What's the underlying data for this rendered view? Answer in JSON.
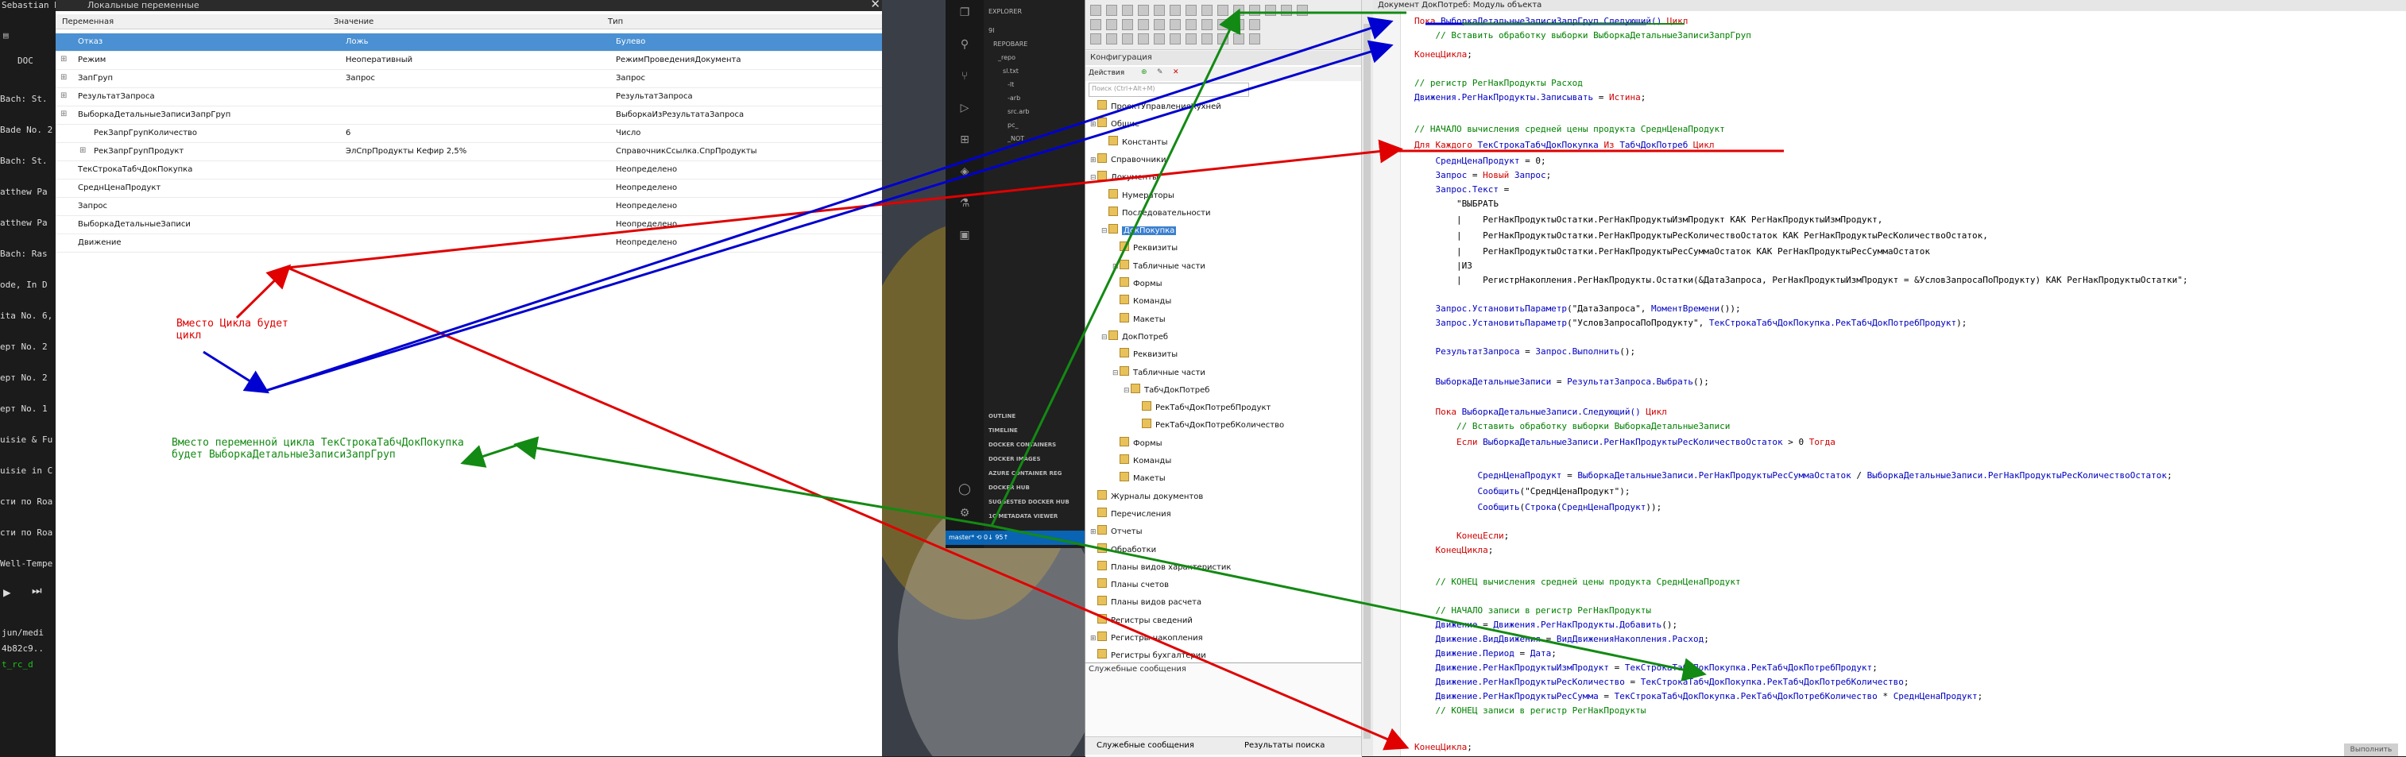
{
  "left_strip": {
    "user": "Sebastian B",
    "tab": "DOC",
    "tracks": [
      "Bach: St.",
      "Bade No. 2",
      "Bach: St.",
      "atthew Pa",
      "atthew Pa",
      "Bach: Ras",
      "ode, In D",
      "ita No. 6,",
      "ерт No. 2",
      "ерт No. 2",
      "ерт No. 1",
      "uisie & Fu",
      "uisie in C",
      "сти по Roa",
      "сти по Roa",
      "Well-Tempe"
    ],
    "path_lines": [
      "jun/medi",
      "4b82c9..",
      "t_rc_d"
    ]
  },
  "variables": {
    "title": "Локальные переменные",
    "columns": [
      "Переменная",
      "Значение",
      "Тип"
    ],
    "rows": [
      {
        "name": "Отказ",
        "value": "Ложь",
        "type": "Булево",
        "selected": true,
        "expandable": false
      },
      {
        "name": "Режим",
        "value": "Неоперативный",
        "type": "РежимПроведенияДокумента",
        "expandable": true
      },
      {
        "name": "ЗапГруп",
        "value": "Запрос",
        "type": "Запрос",
        "expandable": true
      },
      {
        "name": "РезультатЗапроса",
        "value": "",
        "type": "РезультатЗапроса",
        "expandable": true
      },
      {
        "name": "ВыборкаДетальныеЗаписиЗапрГруп",
        "value": "",
        "type": "ВыборкаИзРезультатаЗапроса",
        "expandable": true
      },
      {
        "name": "РекЗапрГрупКоличество",
        "value": "6",
        "type": "Число",
        "indent": true
      },
      {
        "name": "РекЗапрГрупПродукт",
        "value": "ЭлСпрПродукты Кефир 2,5%",
        "type": "СправочникСсылка.СпрПродукты",
        "indent": true,
        "expandable": true
      },
      {
        "name": "ТекСтрокаТабчДокПокупка",
        "value": "",
        "type": "Неопределено"
      },
      {
        "name": "СреднЦенаПродукт",
        "value": "",
        "type": "Неопределено"
      },
      {
        "name": "Запрос",
        "value": "",
        "type": "Неопределено"
      },
      {
        "name": "ВыборкаДетальныеЗаписи",
        "value": "",
        "type": "Неопределено"
      },
      {
        "name": "Движение",
        "value": "",
        "type": "Неопределено"
      }
    ]
  },
  "vscode": {
    "explorer": "EXPLORER",
    "items": [
      "9I",
      "REPOBARE",
      "_repo",
      "sl.txt",
      "-lt",
      "-arb",
      "src.arb",
      "pc_",
      "_NOT",
      "OUTLINE",
      "TIMELINE",
      "DOCKER CONTAINERS",
      "DOCKER IMAGES",
      "AZURE CONTAINER REG",
      "DOCKER HUB",
      "SUGGESTED DOCKER HUB",
      "1C METADATA VIEWER"
    ],
    "status": "master*  ⟲ 0↓ 95↑"
  },
  "configurator": {
    "actions_label": "Действия",
    "panel_title": "Конфигурация",
    "search_placeholder": "Поиск (Ctrl+Alt+M)",
    "tree": [
      {
        "label": "ПроектУправленияКухней",
        "level": 0
      },
      {
        "label": "Общие",
        "level": 0,
        "exp": "⊞"
      },
      {
        "label": "Константы",
        "level": 1
      },
      {
        "label": "Справочники",
        "level": 0,
        "exp": "⊞"
      },
      {
        "label": "Документы",
        "level": 0,
        "exp": "⊟"
      },
      {
        "label": "Нумераторы",
        "level": 1
      },
      {
        "label": "Последовательности",
        "level": 1
      },
      {
        "label": "ДокПокупка",
        "level": 1,
        "exp": "⊟",
        "selected": true
      },
      {
        "label": "Реквизиты",
        "level": 2
      },
      {
        "label": "Табличные части",
        "level": 2,
        "exp": "⊞"
      },
      {
        "label": "Формы",
        "level": 2
      },
      {
        "label": "Команды",
        "level": 2
      },
      {
        "label": "Макеты",
        "level": 2
      },
      {
        "label": "ДокПотреб",
        "level": 1,
        "exp": "⊟"
      },
      {
        "label": "Реквизиты",
        "level": 2
      },
      {
        "label": "Табличные части",
        "level": 2,
        "exp": "⊟"
      },
      {
        "label": "ТабчДокПотреб",
        "level": 3,
        "exp": "⊟"
      },
      {
        "label": "РекТабчДокПотребПродукт",
        "level": 4
      },
      {
        "label": "РекТабчДокПотребКоличество",
        "level": 4
      },
      {
        "label": "Формы",
        "level": 2
      },
      {
        "label": "Команды",
        "level": 2
      },
      {
        "label": "Макеты",
        "level": 2
      },
      {
        "label": "Журналы документов",
        "level": 0
      },
      {
        "label": "Перечисления",
        "level": 0
      },
      {
        "label": "Отчеты",
        "level": 0,
        "exp": "⊞"
      },
      {
        "label": "Обработки",
        "level": 0
      },
      {
        "label": "Планы видов характеристик",
        "level": 0
      },
      {
        "label": "Планы счетов",
        "level": 0
      },
      {
        "label": "Планы видов расчета",
        "level": 0
      },
      {
        "label": "Регистры сведений",
        "level": 0
      },
      {
        "label": "Регистры накопления",
        "level": 0,
        "exp": "⊞"
      },
      {
        "label": "Регистры бухгалтерии",
        "level": 0
      }
    ],
    "messages_title": "Служебные сообщения",
    "tab_messages": "Служебные сообщения",
    "tab_search": "Результаты поиска"
  },
  "editor": {
    "title": "Документ ДокПотреб: Модуль объекта",
    "lines": [
      [
        [
          "kw",
          "Пока "
        ],
        [
          "id",
          "ВыборкаДетальныеЗаписиЗапрГруп.Следующий() "
        ],
        [
          "kw",
          "Цикл"
        ]
      ],
      [
        [
          "cm",
          "    // Вставить обработку выборки ВыборкаДетальныеЗаписиЗапрГруп"
        ]
      ],
      [
        [
          "kw",
          "КонецЦикла"
        ],
        [
          "st",
          ";"
        ]
      ],
      [
        [
          "st",
          ""
        ]
      ],
      [
        [
          "cm",
          "// регистр РегНакПродукты Расход"
        ]
      ],
      [
        [
          "id",
          "Движения.РегНакПродукты.Записывать "
        ],
        [
          "st",
          "= "
        ],
        [
          "kw",
          "Истина"
        ],
        [
          "st",
          ";"
        ]
      ],
      [
        [
          "st",
          ""
        ]
      ],
      [
        [
          "cm",
          "// НАЧАЛО вычисления средней цены продукта СреднЦенаПродукт"
        ]
      ],
      [
        [
          "kw",
          "Для Каждого "
        ],
        [
          "id",
          "ТекСтрокаТабчДокПокупка "
        ],
        [
          "kw",
          "Из "
        ],
        [
          "id",
          "ТабчДокПотреб "
        ],
        [
          "kw",
          "Цикл"
        ]
      ],
      [
        [
          "id",
          "    СреднЦенаПродукт "
        ],
        [
          "st",
          "= 0;"
        ]
      ],
      [
        [
          "id",
          "    Запрос "
        ],
        [
          "st",
          "= "
        ],
        [
          "kw",
          "Новый "
        ],
        [
          "id",
          "Запрос"
        ],
        [
          "st",
          ";"
        ]
      ],
      [
        [
          "id",
          "    Запрос.Текст "
        ],
        [
          "st",
          "="
        ]
      ],
      [
        [
          "st",
          "        \"ВЫБРАТЬ"
        ]
      ],
      [
        [
          "st",
          "        |    РегНакПродуктыОстатки.РегНакПродуктыИзмПродукт КАК РегНакПродуктыИзмПродукт,"
        ]
      ],
      [
        [
          "st",
          "        |    РегНакПродуктыОстатки.РегНакПродуктыРесКоличествоОстаток КАК РегНакПродуктыРесКоличествоОстаток,"
        ]
      ],
      [
        [
          "st",
          "        |    РегНакПродуктыОстатки.РегНакПродуктыРесСуммаОстаток КАК РегНакПродуктыРесСуммаОстаток"
        ]
      ],
      [
        [
          "st",
          "        |ИЗ"
        ]
      ],
      [
        [
          "st",
          "        |    РегистрНакопления.РегНакПродукты.Остатки(&ДатаЗапроса, РегНакПродуктыИзмПродукт = &УсловЗапросаПоПродукту) КАК РегНакПродуктыОстатки\";"
        ]
      ],
      [
        [
          "st",
          ""
        ]
      ],
      [
        [
          "id",
          "    Запрос.УстановитьПараметр"
        ],
        [
          "st",
          "(\"ДатаЗапроса\", "
        ],
        [
          "id",
          "МоментВремени"
        ],
        [
          "st",
          "());"
        ]
      ],
      [
        [
          "id",
          "    Запрос.УстановитьПараметр"
        ],
        [
          "st",
          "(\"УсловЗапросаПоПродукту\", "
        ],
        [
          "id",
          "ТекСтрокаТабчДокПокупка.РекТабчДокПотребПродукт"
        ],
        [
          "st",
          ");"
        ]
      ],
      [
        [
          "st",
          ""
        ]
      ],
      [
        [
          "id",
          "    РезультатЗапроса "
        ],
        [
          "st",
          "= "
        ],
        [
          "id",
          "Запрос.Выполнить"
        ],
        [
          "st",
          "();"
        ]
      ],
      [
        [
          "st",
          ""
        ]
      ],
      [
        [
          "id",
          "    ВыборкаДетальныеЗаписи "
        ],
        [
          "st",
          "= "
        ],
        [
          "id",
          "РезультатЗапроса.Выбрать"
        ],
        [
          "st",
          "();"
        ]
      ],
      [
        [
          "st",
          ""
        ]
      ],
      [
        [
          "kw",
          "    Пока "
        ],
        [
          "id",
          "ВыборкаДетальныеЗаписи.Следующий() "
        ],
        [
          "kw",
          "Цикл"
        ]
      ],
      [
        [
          "cm",
          "        // Вставить обработку выборки ВыборкаДетальныеЗаписи"
        ]
      ],
      [
        [
          "kw",
          "        Если "
        ],
        [
          "id",
          "ВыборкаДетальныеЗаписи.РегНакПродуктыРесКоличествоОстаток "
        ],
        [
          "st",
          "> 0 "
        ],
        [
          "kw",
          "Тогда"
        ]
      ],
      [
        [
          "st",
          ""
        ]
      ],
      [
        [
          "id",
          "            СреднЦенаПродукт "
        ],
        [
          "st",
          "= "
        ],
        [
          "id",
          "ВыборкаДетальныеЗаписи.РегНакПродуктыРесСуммаОстаток "
        ],
        [
          "st",
          "/ "
        ],
        [
          "id",
          "ВыборкаДетальныеЗаписи.РегНакПродуктыРесКоличествоОстаток"
        ],
        [
          "st",
          ";"
        ]
      ],
      [
        [
          "id",
          "            Сообщить"
        ],
        [
          "st",
          "(\"СреднЦенаПродукт\");"
        ]
      ],
      [
        [
          "id",
          "            Сообщить"
        ],
        [
          "st",
          "("
        ],
        [
          "id",
          "Строка"
        ],
        [
          "st",
          "("
        ],
        [
          "id",
          "СреднЦенаПродукт"
        ],
        [
          "st",
          "));"
        ]
      ],
      [
        [
          "st",
          ""
        ]
      ],
      [
        [
          "kw",
          "        КонецЕсли"
        ],
        [
          "st",
          ";"
        ]
      ],
      [
        [
          "kw",
          "    КонецЦикла"
        ],
        [
          "st",
          ";"
        ]
      ],
      [
        [
          "st",
          ""
        ]
      ],
      [
        [
          "cm",
          "    // КОНЕЦ вычисления средней цены продукта СреднЦенаПродукт"
        ]
      ],
      [
        [
          "st",
          ""
        ]
      ],
      [
        [
          "cm",
          "    // НАЧАЛО записи в регистр РегНакПродукты"
        ]
      ],
      [
        [
          "id",
          "    Движение "
        ],
        [
          "st",
          "= "
        ],
        [
          "id",
          "Движения.РегНакПродукты.Добавить"
        ],
        [
          "st",
          "();"
        ]
      ],
      [
        [
          "id",
          "    Движение.ВидДвижения "
        ],
        [
          "st",
          "= "
        ],
        [
          "id",
          "ВидДвиженияНакопления.Расход"
        ],
        [
          "st",
          ";"
        ]
      ],
      [
        [
          "id",
          "    Движение.Период "
        ],
        [
          "st",
          "= "
        ],
        [
          "id",
          "Дата"
        ],
        [
          "st",
          ";"
        ]
      ],
      [
        [
          "id",
          "    Движение.РегНакПродуктыИзмПродукт "
        ],
        [
          "st",
          "= "
        ],
        [
          "id",
          "ТекСтрокаТабчДокПокупка.РекТабчДокПотребПродукт"
        ],
        [
          "st",
          ";"
        ]
      ],
      [
        [
          "id",
          "    Движение.РегНакПродуктыРесКоличество "
        ],
        [
          "st",
          "= "
        ],
        [
          "id",
          "ТекСтрокаТабчДокПокупка.РекТабчДокПотребКоличество"
        ],
        [
          "st",
          ";"
        ]
      ],
      [
        [
          "id",
          "    Движение.РегНакПродуктыРесСумма "
        ],
        [
          "st",
          "= "
        ],
        [
          "id",
          "ТекСтрокаТабчДокПокупка.РекТабчДокПотребКоличество "
        ],
        [
          "st",
          "* "
        ],
        [
          "id",
          "СреднЦенаПродукт"
        ],
        [
          "st",
          ";"
        ]
      ],
      [
        [
          "cm",
          "    // КОНЕЦ записи в регистр РегНакПродукты"
        ]
      ],
      [
        [
          "st",
          ""
        ]
      ],
      [
        [
          "st",
          ""
        ]
      ],
      [
        [
          "kw",
          "КонецЦикла"
        ],
        [
          "st",
          ";"
        ]
      ]
    ]
  },
  "annotations": {
    "red_note": "Вместо Цикла будет\nцикл",
    "green_note": "Вместо переменной цикла ТекСтрокаТабчДокПокупка\nбудет ВыборкаДетальныеЗаписиЗапрГруп",
    "red_color": "#e00000",
    "blue_color": "#0000d0",
    "green_color": "#138a13"
  },
  "bottom_button": "Выполнить"
}
